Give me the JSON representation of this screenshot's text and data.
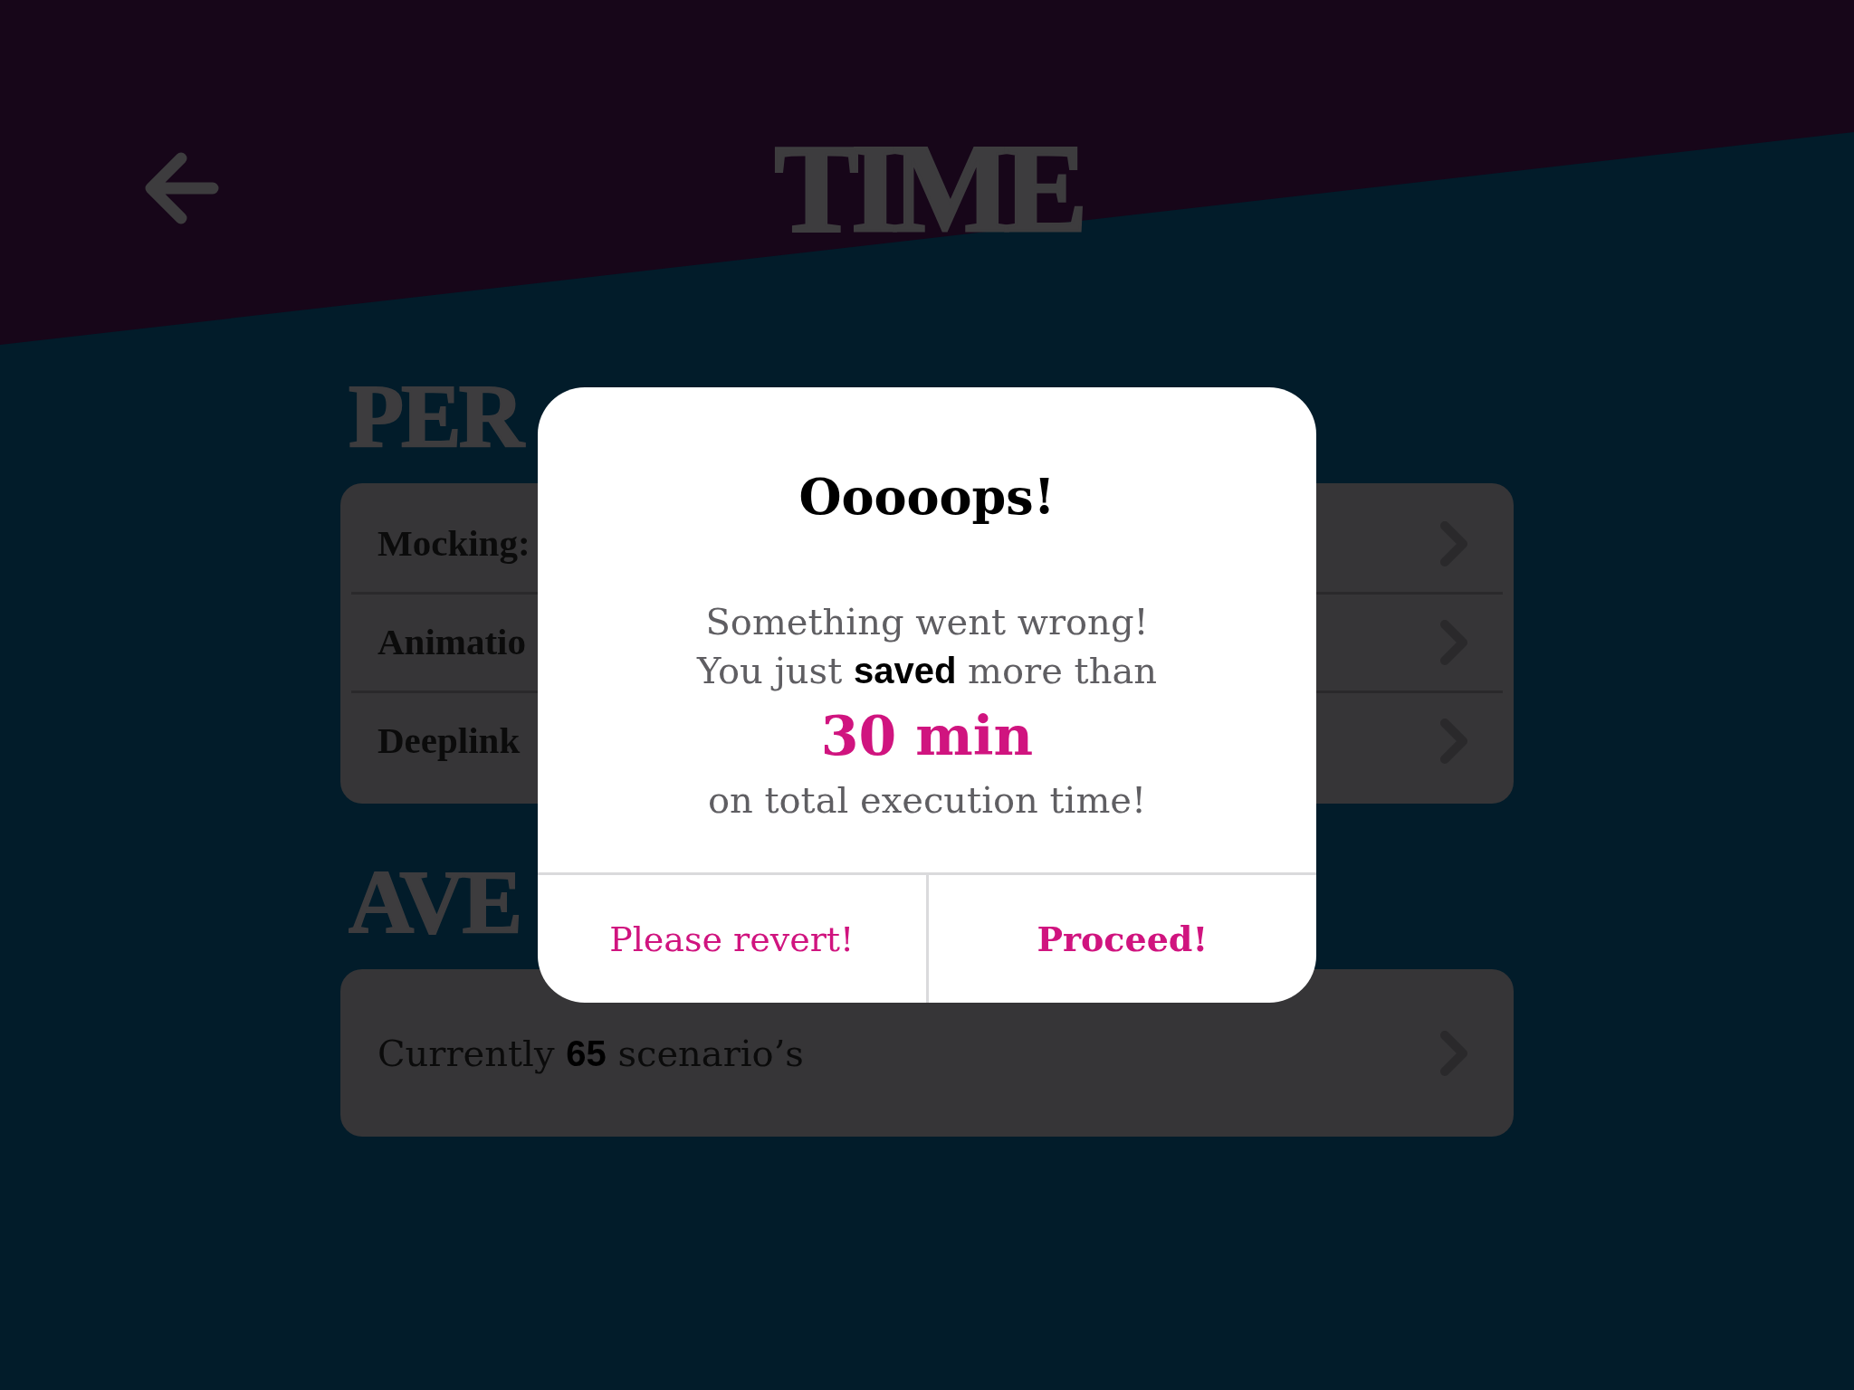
{
  "header": {
    "title": "TIME"
  },
  "sections": [
    {
      "kind": "breakdown",
      "heading": "PER",
      "rows": [
        {
          "label": "Mocking:"
        },
        {
          "label": "Animatio"
        },
        {
          "label": "Deeplink"
        }
      ]
    },
    {
      "kind": "summary",
      "heading": "AVE",
      "rows": [
        {
          "label": "Currently **65** scenario’s"
        }
      ]
    }
  ],
  "dialog": {
    "title": "Ooooops!",
    "message_lines": [
      "Something went wrong!",
      "You just **saved** more than"
    ],
    "amount": "30 min",
    "note": "on total execution time!",
    "buttons": [
      {
        "label": "Please revert!",
        "kind": "cancel"
      },
      {
        "label": "Proceed!",
        "kind": "confirm"
      }
    ]
  }
}
